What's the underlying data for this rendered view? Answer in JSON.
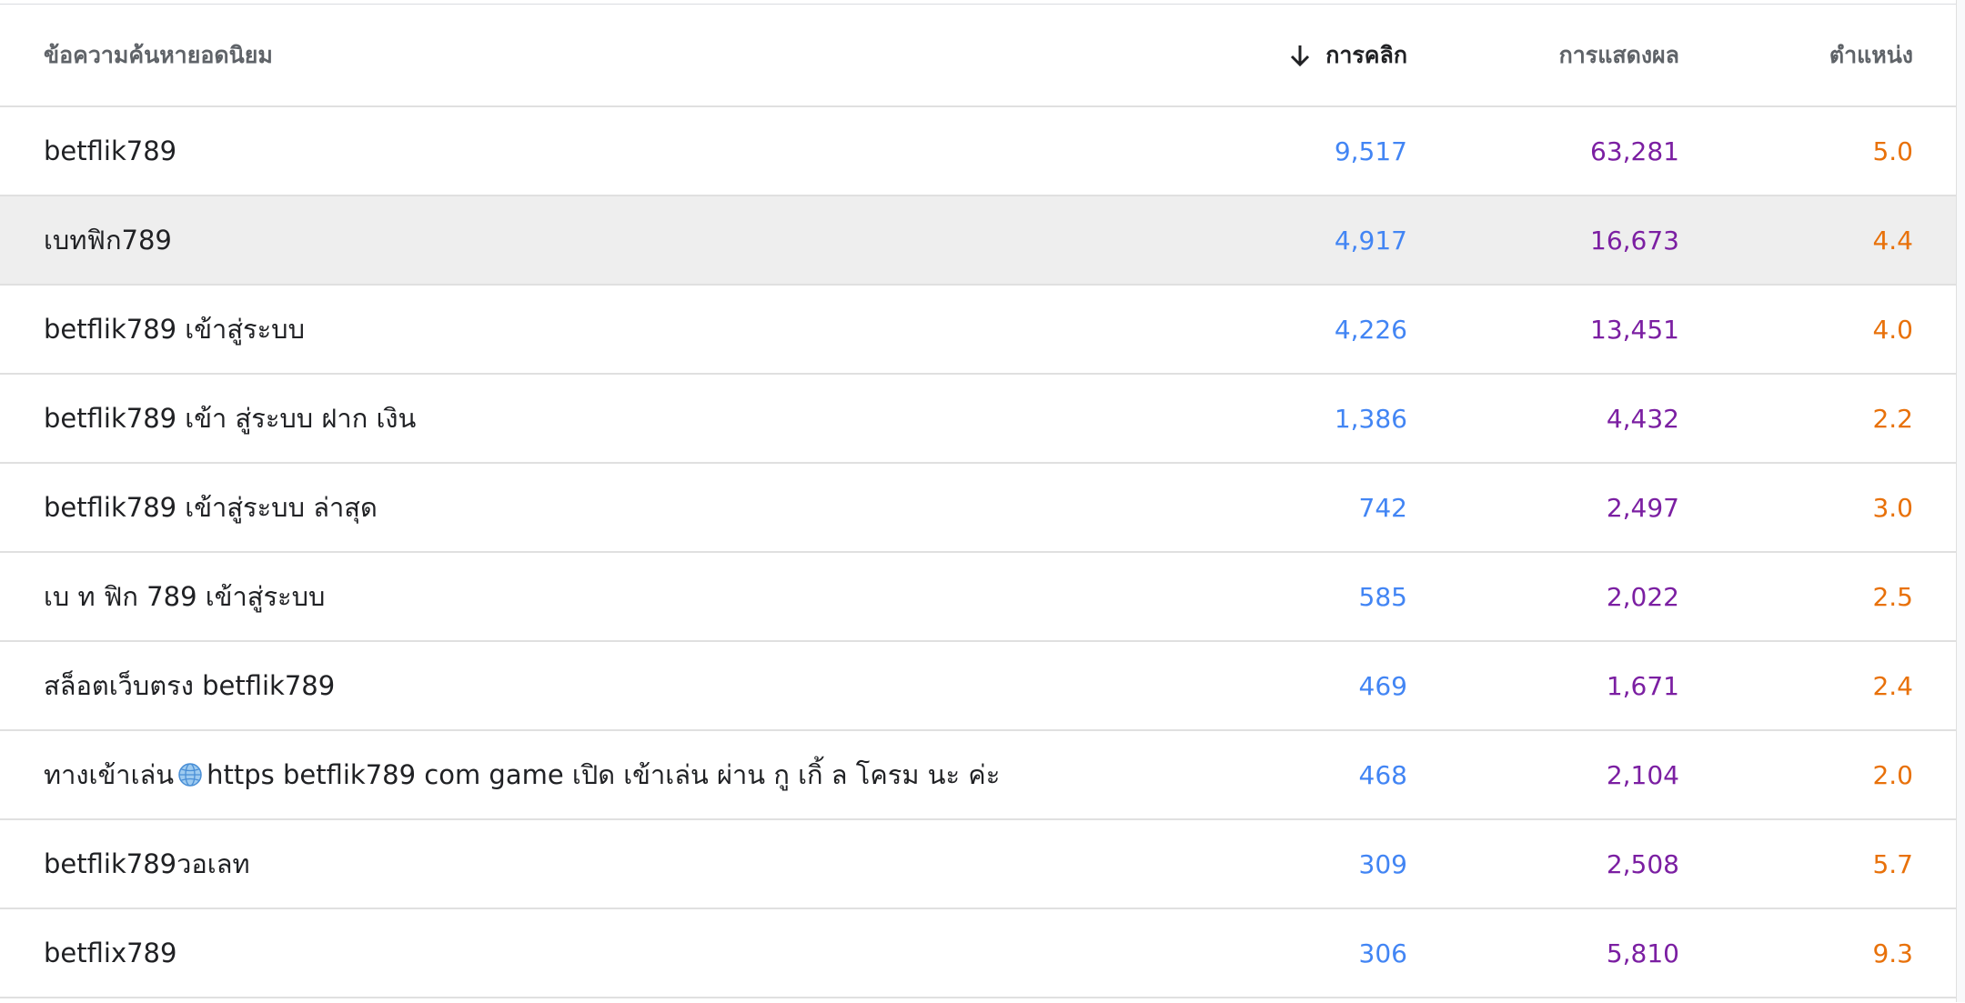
{
  "header": {
    "query": "ข้อความค้นหายอดนิยม",
    "clicks": "การคลิก",
    "impressions": "การแสดงผล",
    "position": "ตำแหน่ง",
    "sorted_by": "clicks",
    "sort_direction": "descending",
    "sort_icon": "arrow-down-icon"
  },
  "colors": {
    "clicks": "#4285f4",
    "impressions": "#7b1fa2",
    "position": "#e8710a",
    "highlight_row": "#eeeeee"
  },
  "rows": [
    {
      "query": "betflik789",
      "clicks": "9,517",
      "impressions": "63,281",
      "position": "5.0"
    },
    {
      "query": "เบทฟิก789",
      "clicks": "4,917",
      "impressions": "16,673",
      "position": "4.4",
      "highlighted": true
    },
    {
      "query": "betflik789 เข้าสู่ระบบ",
      "clicks": "4,226",
      "impressions": "13,451",
      "position": "4.0"
    },
    {
      "query": "betflik789 เข้า สู่ระบบ ฝาก เงิน",
      "clicks": "1,386",
      "impressions": "4,432",
      "position": "2.2"
    },
    {
      "query": "betflik789 เข้าสู่ระบบ ล่าสุด",
      "clicks": "742",
      "impressions": "2,497",
      "position": "3.0"
    },
    {
      "query": "เบ ท ฟิก 789 เข้าสู่ระบบ",
      "clicks": "585",
      "impressions": "2,022",
      "position": "2.5"
    },
    {
      "query": "สล็อตเว็บตรง betflik789",
      "clicks": "469",
      "impressions": "1,671",
      "position": "2.4"
    },
    {
      "query_before": "ทางเข้าเล่น",
      "query_icon": "globe-icon",
      "query_after": "https betflik789 com game เปิด เข้าเล่น ผ่าน กู เกิ้ ล โครม นะ ค่ะ",
      "clicks": "468",
      "impressions": "2,104",
      "position": "2.0"
    },
    {
      "query": "betflik789วอเลท",
      "clicks": "309",
      "impressions": "2,508",
      "position": "5.7"
    },
    {
      "query": "betflix789",
      "clicks": "306",
      "impressions": "5,810",
      "position": "9.3"
    }
  ]
}
